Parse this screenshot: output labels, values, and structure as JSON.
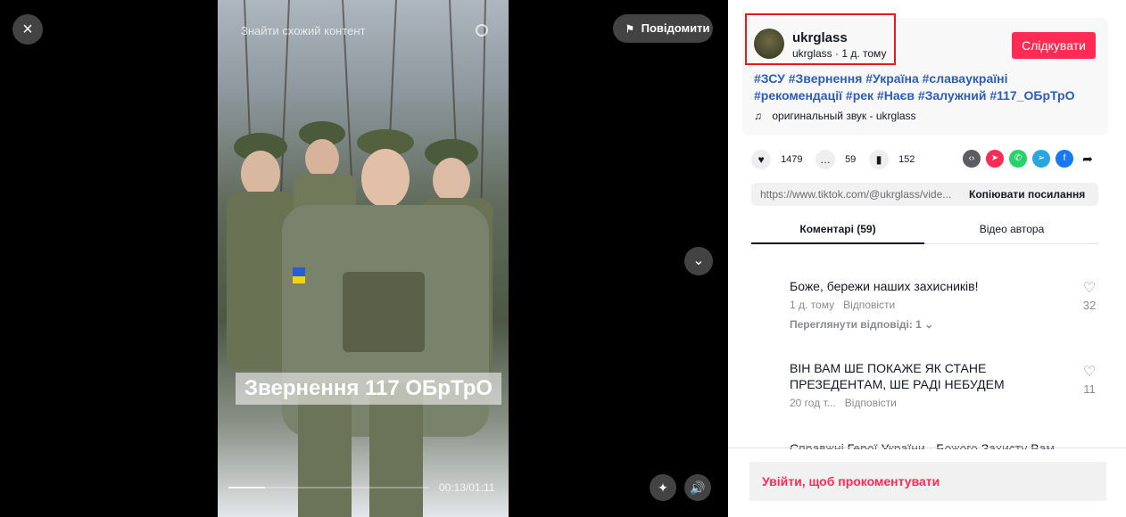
{
  "player": {
    "close_label": "×",
    "report_label": "Повідомити",
    "search_placeholder": "Знайти схожий контент",
    "video_caption": "Звернення 117 ОБрТрО",
    "time": "00:13/01:11",
    "progress": 0.18
  },
  "author": {
    "username": "ukrglass",
    "subline": "ukrglass · 1 д. тому",
    "follow_label": "Слідкувати"
  },
  "description": {
    "tags": "#ЗСУ #Звернення #Україна #славаукраїні #рекомендації #рек #Наєв #Залужний #117_ОБрТрО",
    "sound": "оригинальный звук - ukrglass"
  },
  "stats": {
    "likes": "1479",
    "comments": "59",
    "saves": "152"
  },
  "link": {
    "url": "https://www.tiktok.com/@ukrglass/vide...",
    "copy_label": "Копіювати посилання"
  },
  "tabs": {
    "comments": "Коментарі (59)",
    "author_videos": "Відео автора"
  },
  "comments": [
    {
      "text": "Боже, бережи наших захисників!",
      "time": "1 д. тому",
      "reply": "Відповісти",
      "view_replies": "Переглянути відповіді: 1",
      "likes": "32"
    },
    {
      "text": "ВІН ВАМ ШЕ ПОКАЖЕ ЯК СТАНЕ ПРЕЗЕДЕНТАМ, ШЕ РАДІ НЕБУДЕМ",
      "time": "20 год т...",
      "reply": "Відповісти",
      "likes": "11"
    },
    {
      "text": "Справжні Герої України - Божого Захисту Вам"
    }
  ],
  "login_prompt": "Увійти, щоб прокоментувати",
  "colors": {
    "accent": "#fe2c55",
    "hashtag": "#2b5db9",
    "highlight_box": "#e41c1c"
  }
}
